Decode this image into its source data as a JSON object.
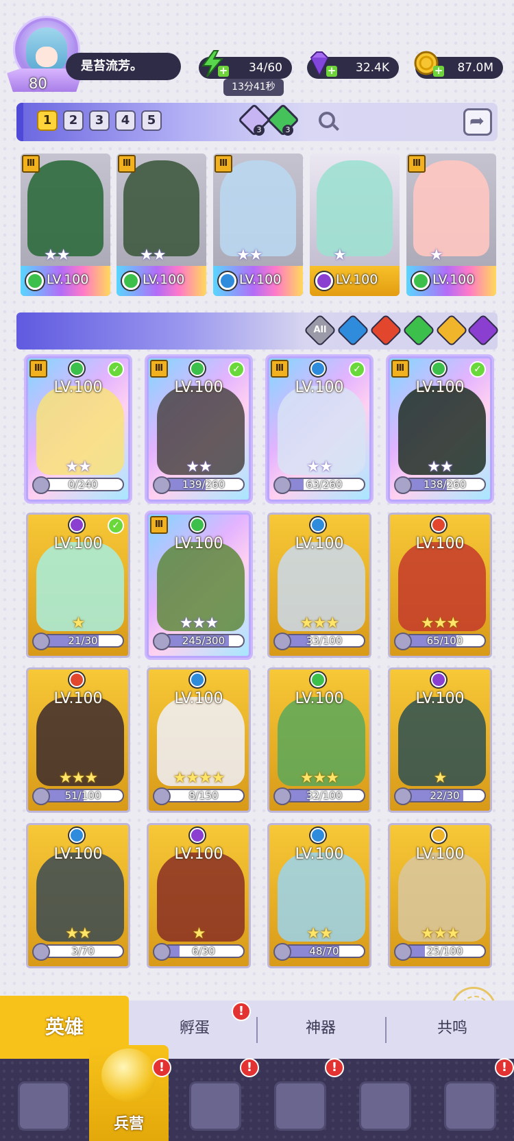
{
  "player": {
    "level": "80",
    "name": "是苔流芳。"
  },
  "resources": {
    "energy": {
      "icon": "lightning-icon",
      "value": "34/60",
      "timer": "13分41秒"
    },
    "gems": {
      "icon": "purple-gem-icon",
      "value": "32.4K"
    },
    "gold": {
      "icon": "gold-coin-icon",
      "value": "87.0M"
    }
  },
  "team_tabs": [
    "1",
    "2",
    "3",
    "4",
    "5"
  ],
  "team_selected": "1",
  "team_counts": {
    "purple": "3",
    "green": "3"
  },
  "formation": [
    {
      "lv": "LV.100",
      "element": "wind",
      "stars": "★★",
      "rank": "Ⅲ",
      "color": "#2f6b3d"
    },
    {
      "lv": "LV.100",
      "element": "wind",
      "stars": "★★",
      "rank": "Ⅲ",
      "color": "#3f5a3f"
    },
    {
      "lv": "LV.100",
      "element": "water",
      "stars": "★★",
      "rank": "Ⅲ",
      "color": "#b9d7ef"
    },
    {
      "lv": "LV.100",
      "element": "dark",
      "stars": "★",
      "rank": "",
      "color": "#9fe0d2"
    },
    {
      "lv": "LV.100",
      "element": "wind",
      "stars": "★",
      "rank": "Ⅲ",
      "color": "#ffc6c1"
    }
  ],
  "filter": {
    "all_label": "All",
    "elements": [
      "water",
      "fire",
      "wind",
      "light",
      "dark"
    ]
  },
  "heroes": [
    {
      "lv": "LV.100",
      "element": "wind",
      "stars": "★★",
      "progress": "0/240",
      "fraction": 0.0,
      "rank": "Ⅲ",
      "check": true,
      "style": "rainbow",
      "color": "#f8e27a"
    },
    {
      "lv": "LV.100",
      "element": "wind",
      "stars": "★★",
      "progress": "139/260",
      "fraction": 0.53,
      "rank": "Ⅲ",
      "check": true,
      "style": "rainbow",
      "color": "#4b4545"
    },
    {
      "lv": "LV.100",
      "element": "water",
      "stars": "★★",
      "progress": "63/260",
      "fraction": 0.24,
      "rank": "Ⅲ",
      "check": true,
      "style": "rainbow",
      "color": "#d7e3f4"
    },
    {
      "lv": "LV.100",
      "element": "wind",
      "stars": "★★",
      "progress": "138/260",
      "fraction": 0.53,
      "rank": "Ⅲ",
      "check": true,
      "style": "rainbow",
      "color": "#1e2f23"
    },
    {
      "lv": "LV.100",
      "element": "dark",
      "stars": "★",
      "progress": "21/30",
      "fraction": 0.7,
      "rank": "",
      "check": true,
      "style": "gold",
      "color": "#a7efe0"
    },
    {
      "lv": "LV.100",
      "element": "wind",
      "stars": "★★★",
      "progress": "245/300",
      "fraction": 0.82,
      "rank": "Ⅲ",
      "check": false,
      "style": "rainbow",
      "color": "#5e8a3c"
    },
    {
      "lv": "LV.100",
      "element": "water",
      "stars": "★★★",
      "progress": "33/100",
      "fraction": 0.33,
      "rank": "",
      "check": false,
      "style": "gold",
      "color": "#c9d9ef"
    },
    {
      "lv": "LV.100",
      "element": "fire",
      "stars": "★★★",
      "progress": "65/100",
      "fraction": 0.65,
      "rank": "",
      "check": false,
      "style": "gold",
      "color": "#c43a2b"
    },
    {
      "lv": "LV.100",
      "element": "fire",
      "stars": "★★★",
      "progress": "51/100",
      "fraction": 0.51,
      "rank": "",
      "check": false,
      "style": "gold",
      "color": "#3c2a2e"
    },
    {
      "lv": "LV.100",
      "element": "water",
      "stars": "★★★★",
      "progress": "8/150",
      "fraction": 0.05,
      "rank": "",
      "check": false,
      "style": "gold",
      "color": "#eef0fb"
    },
    {
      "lv": "LV.100",
      "element": "wind",
      "stars": "★★★",
      "progress": "32/100",
      "fraction": 0.32,
      "rank": "",
      "check": false,
      "style": "gold",
      "color": "#5aa85a"
    },
    {
      "lv": "LV.100",
      "element": "dark",
      "stars": "★",
      "progress": "22/30",
      "fraction": 0.73,
      "rank": "",
      "check": false,
      "style": "gold",
      "color": "#2d5053"
    },
    {
      "lv": "LV.100",
      "element": "water",
      "stars": "★★",
      "progress": "3/70",
      "fraction": 0.04,
      "rank": "",
      "check": false,
      "style": "gold",
      "color": "#3a4a54"
    },
    {
      "lv": "LV.100",
      "element": "dark",
      "stars": "★",
      "progress": "6/30",
      "fraction": 0.2,
      "rank": "",
      "check": false,
      "style": "gold",
      "color": "#8a2f24"
    },
    {
      "lv": "LV.100",
      "element": "water",
      "stars": "★★",
      "progress": "48/70",
      "fraction": 0.69,
      "rank": "",
      "check": false,
      "style": "gold",
      "color": "#9ad4ee"
    },
    {
      "lv": "LV.100",
      "element": "light",
      "stars": "★★★",
      "progress": "25/100",
      "fraction": 0.25,
      "rank": "",
      "check": false,
      "style": "gold",
      "color": "#d8c7a0"
    }
  ],
  "tabs": [
    {
      "label": "英雄",
      "active": true,
      "badge": ""
    },
    {
      "label": "孵蛋",
      "active": false,
      "badge": "!"
    },
    {
      "label": "神器",
      "active": false,
      "badge": ""
    },
    {
      "label": "共鸣",
      "active": false,
      "badge": ""
    }
  ],
  "nav": [
    {
      "icon": "cards-icon",
      "label": "",
      "badge": ""
    },
    {
      "icon": "barracks-icon",
      "label": "兵营",
      "badge": "!"
    },
    {
      "icon": "book-icon",
      "label": "",
      "badge": "!"
    },
    {
      "icon": "castle-icon",
      "label": "",
      "badge": "!"
    },
    {
      "icon": "shrine-icon",
      "label": "",
      "badge": ""
    },
    {
      "icon": "scroll-icon",
      "label": "",
      "badge": "!"
    }
  ],
  "colors": {
    "accent": "#f7c21a",
    "panel": "#2f2c48",
    "nav": "#3a3556"
  }
}
